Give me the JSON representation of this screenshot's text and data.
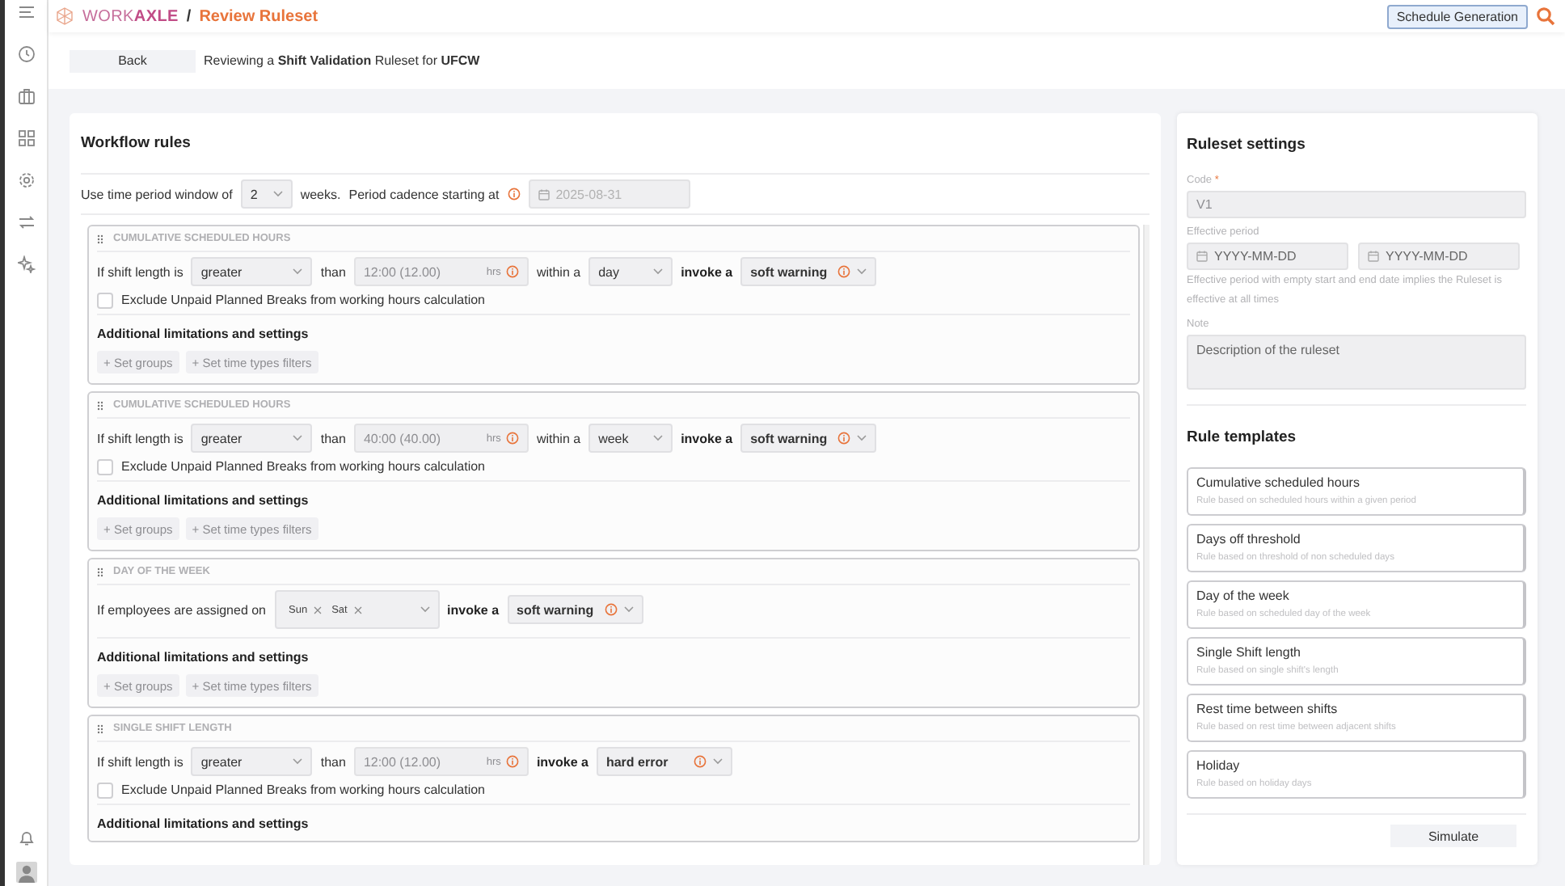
{
  "topbar": {
    "brand": "WORK**AXLE**",
    "separator": "/",
    "page_title": "Review Ruleset",
    "action_button": "Schedule Generation"
  },
  "subheader": {
    "back_button": "Back",
    "description": "Reviewing a **Shift Validation** Ruleset for **UFCW**"
  },
  "workflow": {
    "title": "Workflow rules",
    "period": {
      "label": "Use time period window of",
      "window": "2",
      "unit": "weeks.",
      "cadence_label": "Period cadence starting at",
      "start_date": "2025-08-31"
    },
    "rules": [
      {
        "title": "CUMULATIVE SCHEDULED HOURS",
        "condition": [
          {
            "kind": "text",
            "text": "If shift length is"
          },
          {
            "kind": "select",
            "value": "greater"
          },
          {
            "kind": "text",
            "text": "than"
          },
          {
            "kind": "duration",
            "value": "12:00 (12.00)",
            "unit": "hrs"
          },
          {
            "kind": "text",
            "text": "within a"
          },
          {
            "kind": "select",
            "value": "day"
          },
          {
            "kind": "label",
            "text": "invoke a"
          },
          {
            "kind": "severity",
            "value": "soft warning"
          }
        ],
        "exclude": {
          "label": "Exclude Unpaid Planned Breaks from working hours calculation",
          "checked": false
        },
        "settings_title": "Additional limitations and settings",
        "buttons": [
          "+ Set groups",
          "+ Set time types filters"
        ]
      },
      {
        "title": "CUMULATIVE SCHEDULED HOURS",
        "condition": [
          {
            "kind": "text",
            "text": "If shift length is"
          },
          {
            "kind": "select",
            "value": "greater"
          },
          {
            "kind": "text",
            "text": "than"
          },
          {
            "kind": "duration",
            "value": "40:00 (40.00)",
            "unit": "hrs"
          },
          {
            "kind": "text",
            "text": "within a"
          },
          {
            "kind": "select",
            "value": "week"
          },
          {
            "kind": "label",
            "text": "invoke a"
          },
          {
            "kind": "severity",
            "value": "soft warning"
          }
        ],
        "exclude": {
          "label": "Exclude Unpaid Planned Breaks from working hours calculation",
          "checked": false
        },
        "settings_title": "Additional limitations and settings",
        "buttons": [
          "+ Set groups",
          "+ Set time types filters"
        ]
      },
      {
        "title": "DAY OF THE WEEK",
        "condition": [
          {
            "kind": "text",
            "text": "If employees are assigned on"
          },
          {
            "kind": "tags",
            "tags": [
              "Sun",
              "Sat"
            ]
          },
          {
            "kind": "label",
            "text": "invoke a"
          },
          {
            "kind": "severity",
            "value": "soft warning"
          }
        ],
        "settings_title": "Additional limitations and settings",
        "buttons": [
          "+ Set groups",
          "+ Set time types filters"
        ]
      },
      {
        "title": "SINGLE SHIFT LENGTH",
        "condition": [
          {
            "kind": "text",
            "text": "If shift length is"
          },
          {
            "kind": "select",
            "value": "greater"
          },
          {
            "kind": "text",
            "text": "than"
          },
          {
            "kind": "duration",
            "value": "12:00 (12.00)",
            "unit": "hrs"
          },
          {
            "kind": "label",
            "text": "invoke a"
          },
          {
            "kind": "severity",
            "value": "hard error"
          }
        ],
        "exclude": {
          "label": "Exclude Unpaid Planned Breaks from working hours calculation",
          "checked": false
        },
        "settings_title": "Additional limitations and settings"
      }
    ]
  },
  "settings": {
    "title": "Ruleset settings",
    "code": {
      "label": "Code",
      "required_mark": "*",
      "value": "V1"
    },
    "effective_period": {
      "label": "Effective period",
      "start_placeholder": "YYYY-MM-DD",
      "end_placeholder": "YYYY-MM-DD",
      "hint": "Effective period with empty start and end date implies the Ruleset is effective at all times"
    },
    "note": {
      "label": "Note",
      "placeholder": "Description of the ruleset"
    }
  },
  "templates": {
    "title": "Rule templates",
    "items": [
      {
        "name": "Cumulative scheduled hours",
        "description": "Rule based on scheduled hours within a given period"
      },
      {
        "name": "Days off threshold",
        "description": "Rule based on threshold of non scheduled days"
      },
      {
        "name": "Day of the week",
        "description": "Rule based on scheduled day of the week"
      },
      {
        "name": "Single Shift length",
        "description": "Rule based on single shift's length"
      },
      {
        "name": "Rest time between shifts",
        "description": "Rule based on rest time between adjacent shifts"
      },
      {
        "name": "Holiday",
        "description": "Rule based on holiday days"
      }
    ]
  },
  "simulate_button": "Simulate"
}
